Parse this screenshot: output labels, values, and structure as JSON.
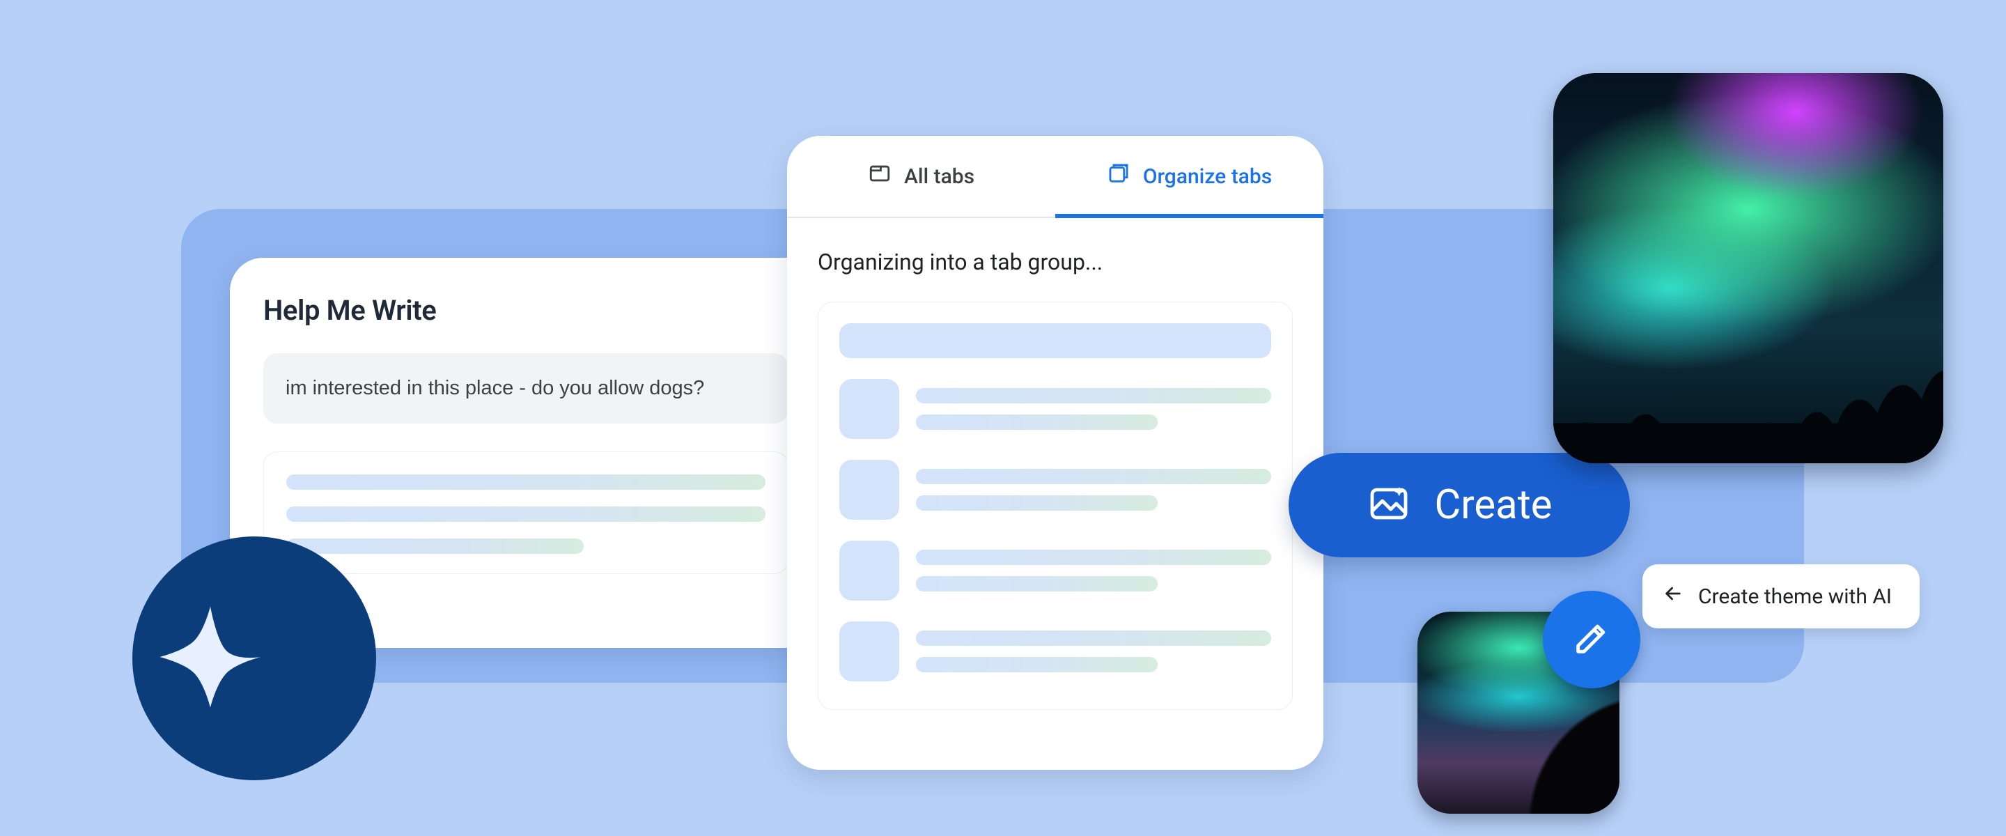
{
  "help_me_write": {
    "title": "Help Me Write",
    "input_value": "im interested in this place - do you allow dogs?"
  },
  "tab_panel": {
    "tab_all": "All tabs",
    "tab_organize": "Organize tabs",
    "status": "Organizing into a tab group..."
  },
  "create_button": {
    "label": "Create"
  },
  "theme_pill": {
    "label": "Create theme with AI"
  },
  "colors": {
    "page_bg": "#b7d0f7",
    "panel_bg": "#8fb4f0",
    "accent_blue": "#1a73e8",
    "deep_blue": "#1a5fd0",
    "avatar_bg": "#0b3d7a"
  },
  "images": {
    "large_tile": "aurora-borealis-forest",
    "small_tile": "aurora-horizon-mountain"
  }
}
